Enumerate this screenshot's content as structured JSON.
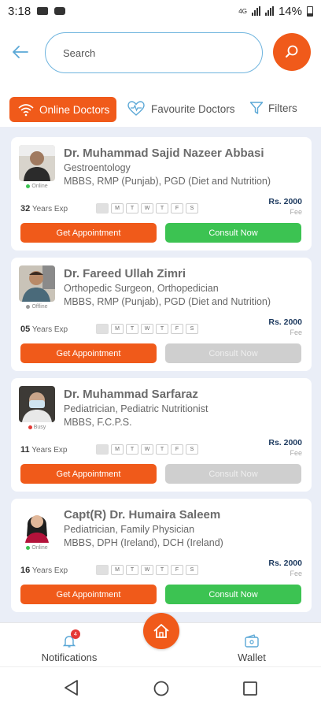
{
  "statusbar": {
    "time": "3:18",
    "network": "4G",
    "battery": "14%"
  },
  "search": {
    "placeholder": "Search",
    "value": ""
  },
  "tabs": {
    "online": "Online Doctors",
    "favourite": "Favourite Doctors",
    "filters": "Filters"
  },
  "colors": {
    "accent": "#f05a1a",
    "consult_active": "#3cc352",
    "consult_disabled": "#cfcfcf",
    "list_bg": "#eaeef7",
    "online": "#3cc352",
    "offline": "#999999",
    "busy": "#e53935"
  },
  "doctors": [
    {
      "name": "Dr. Muhammad Sajid Nazeer Abbasi",
      "specialty": "Gestroentology",
      "qualifications": "MBBS, RMP (Punjab), PGD (Diet and Nutrition)",
      "status": "Online",
      "experience_years": "32",
      "experience_label": "Years Exp",
      "fee": "Rs. 2000",
      "fee_label": "Fee",
      "appointment_label": "Get Appointment",
      "consult_label": "Consult Now",
      "consult_enabled": true
    },
    {
      "name": "Dr. Fareed Ullah Zimri",
      "specialty": "Orthopedic Surgeon, Orthopedician",
      "qualifications": "MBBS, RMP (Punjab), PGD (Diet and Nutrition)",
      "status": "Offline",
      "experience_years": "05",
      "experience_label": "Years Exp",
      "fee": "Rs. 2000",
      "fee_label": "Fee",
      "appointment_label": "Get Appointment",
      "consult_label": "Consult Now",
      "consult_enabled": false
    },
    {
      "name": "Dr. Muhammad Sarfaraz",
      "specialty": "Pediatrician, Pediatric Nutritionist",
      "qualifications": "MBBS, F.C.P.S.",
      "status": "Busy",
      "experience_years": "11",
      "experience_label": "Years Exp",
      "fee": "Rs. 2000",
      "fee_label": "Fee",
      "appointment_label": "Get Appointment",
      "consult_label": "Consult Now",
      "consult_enabled": false
    },
    {
      "name": "Capt(R) Dr. Humaira Saleem",
      "specialty": "Pediatrician, Family Physician",
      "qualifications": "MBBS, DPH (Ireland), DCH (Ireland)",
      "status": "Online",
      "experience_years": "16",
      "experience_label": "Years Exp",
      "fee": "Rs. 2000",
      "fee_label": "Fee",
      "appointment_label": "Get Appointment",
      "consult_label": "Consult Now",
      "consult_enabled": true
    }
  ],
  "week_days": [
    "S",
    "M",
    "T",
    "W",
    "T",
    "F",
    "S"
  ],
  "bottom_nav": {
    "notifications": "Notifications",
    "notification_count": "4",
    "wallet": "Wallet"
  }
}
